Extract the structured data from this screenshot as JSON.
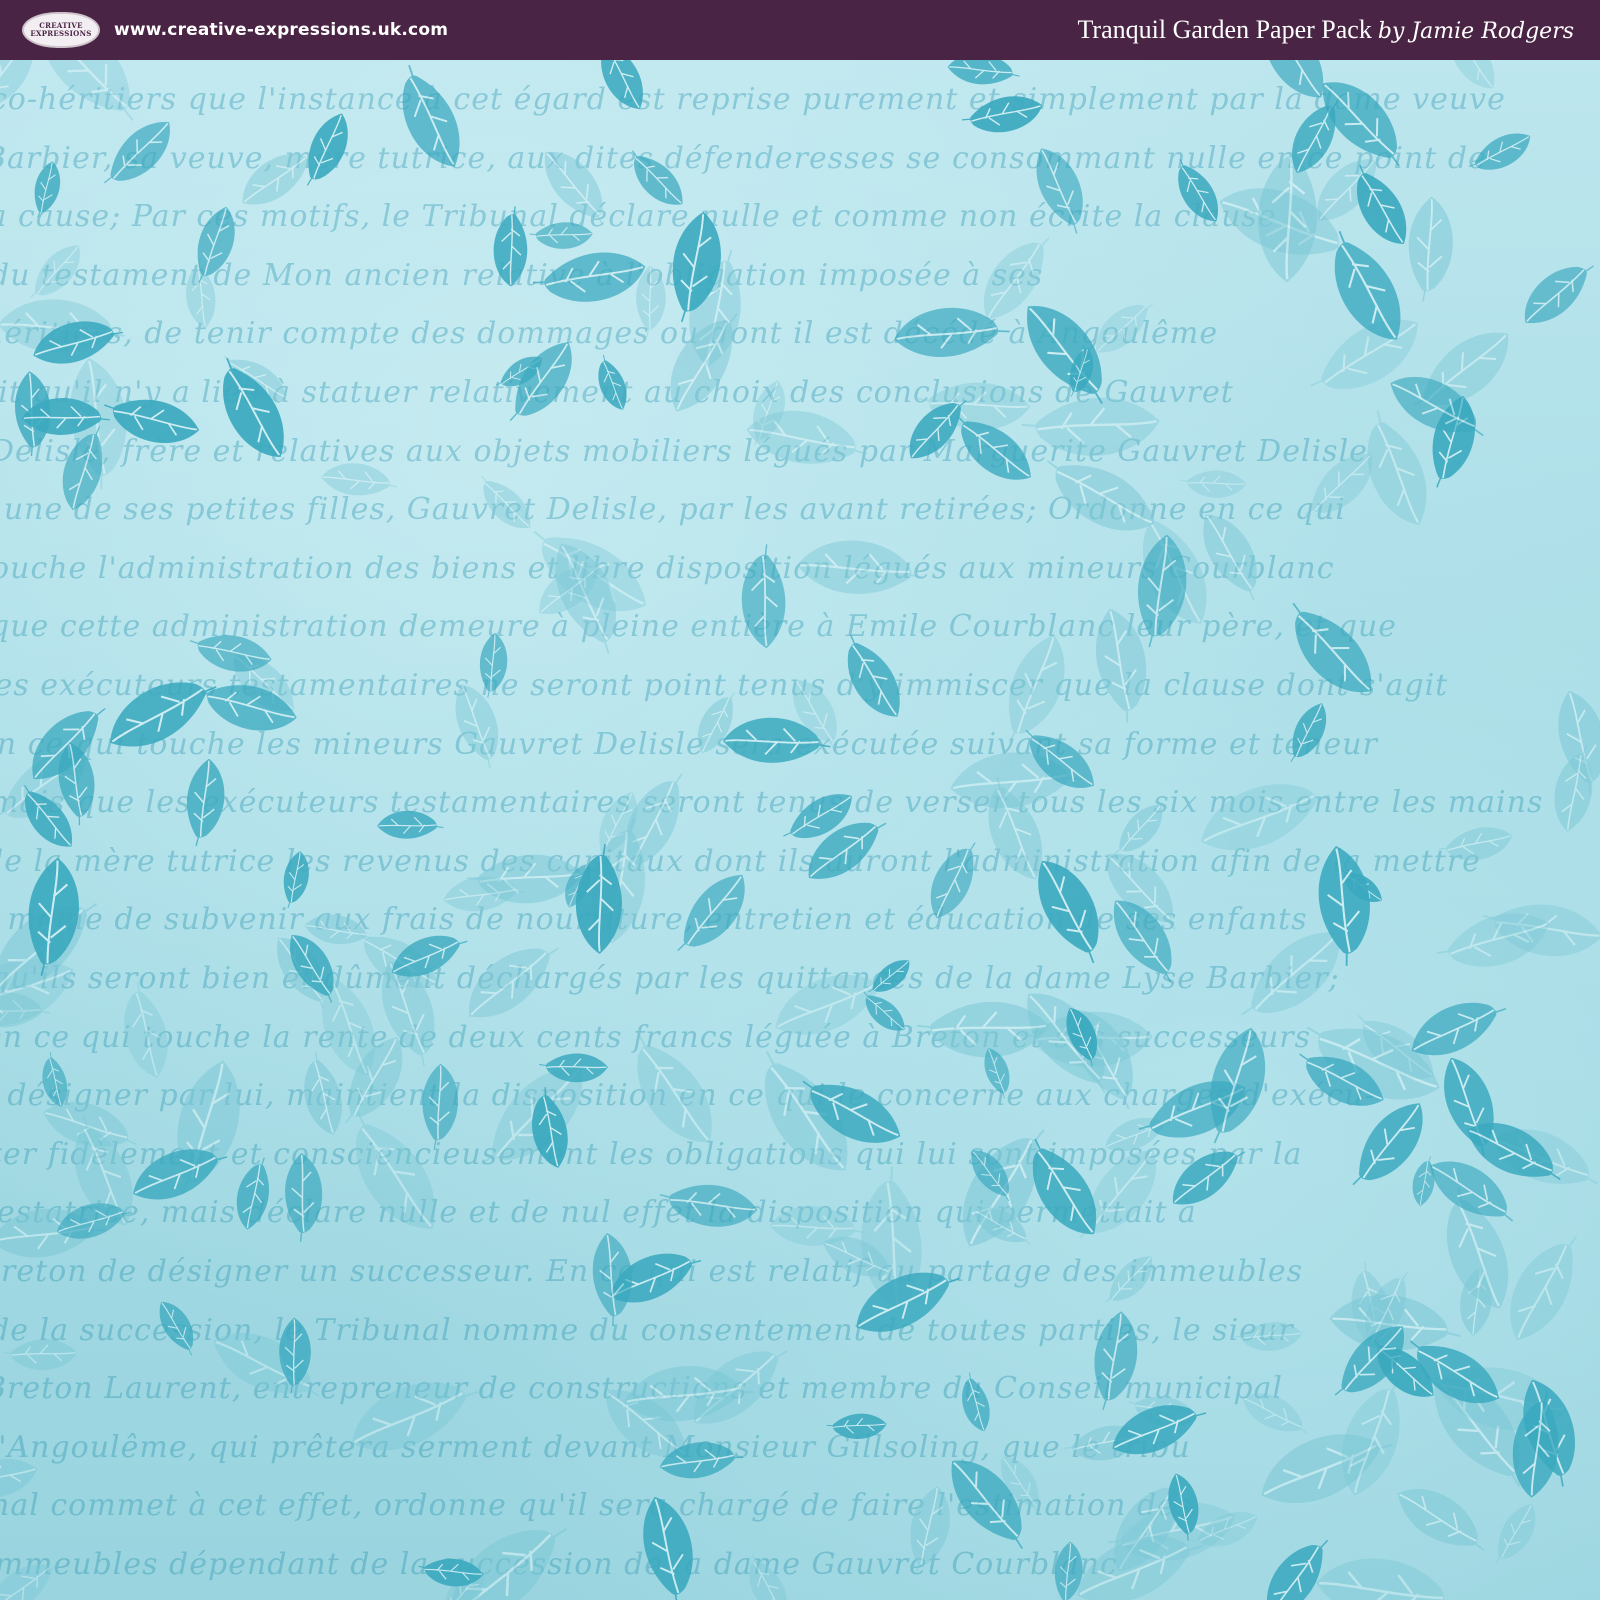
{
  "header": {
    "logo_text": "CREATIVE EXPRESSIONS",
    "website": "www.creative-expressions.uk.com",
    "title": "Tranquil Garden Paper Pack",
    "byline": "by Jamie Rodgers"
  },
  "colors": {
    "header_bg": "#4a2444",
    "paper_light": "#bde6ee",
    "paper_dark": "#99d4df",
    "leaf_dark": "#3aa9bf",
    "leaf_light": "#7cc8d6"
  },
  "pattern": {
    "motif": "leaf-icon",
    "background_script_lines": [
      "co-héritiers que l'instance à cet égard est reprise purement et simplement par la dame veuve",
      "Barbier, sa veuve, mère tutrice, aux dites défenderesses se consommant nulle en ce point de",
      "la cause; Par ces motifs, le Tribunal déclare nulle et comme non écrite la clause",
      "du testament de Mon ancien relative à l'obligation imposée à ses",
      "héritiers, de tenir compte des dommages ou dont il est décédé à Angoulême",
      "dit qu'il n'y a lieu à statuer relativement au choix des conclusions de Gauvret",
      "Delisle, frère et relatives aux objets mobiliers légués par Marguerite Gauvret Delisle",
      "l'une de ses petites filles, Gauvret Delisle, par les avant retirées; Ordonne en ce qui",
      "touche l'administration des biens et libre disposition légués aux mineurs Courblanc",
      "que cette administration demeure à pleine entière à Emile Courblanc leur père, et que",
      "les exécuteurs testamentaires ne seront point tenus d'y immiscer que la clause dont s'agit",
      "en ce qui touche les mineurs Gauvret Delisle sera exécutée suivant sa forme et teneur",
      "mais que les exécuteurs testamentaires seront tenus de verser tous les six mois entre les mains",
      "de la mère tutrice les revenus des capitaux dont ils auront l'administration afin de la mettre",
      "à même de subvenir aux frais de nourriture, entretien et éducation de ses enfants",
      "qu'ils seront bien et dûment déchargés par les quittances de la dame Lyse Barbier;",
      "en ce qui touche la rente de deux cents francs léguée à Breton et ses successeurs",
      "à désigner par lui, maintient la disposition en ce qui le concerne aux charges d'exécu-",
      "ter fidèlement et consciencieusement les obligations qui lui sont imposées par la",
      "testatrice, mais déclare nulle et de nul effet la disposition qui permettait à",
      "Breton de désigner un successeur. En ce qui est relatif au partage des immeubles",
      "de la succession, le Tribunal nomme du consentement de toutes parties, le sieur",
      "Breton Laurent, entrepreneur de constructions et membre du Conseil municipal",
      "d'Angoulême, qui prêtera serment devant Monsieur Gillsoling, que le tribu",
      "nal commet à cet effet, ordonne qu'il sera chargé de faire l'estimation des",
      "immeubles dépendant de la succession de la dame Gauvret Courblanc"
    ]
  }
}
